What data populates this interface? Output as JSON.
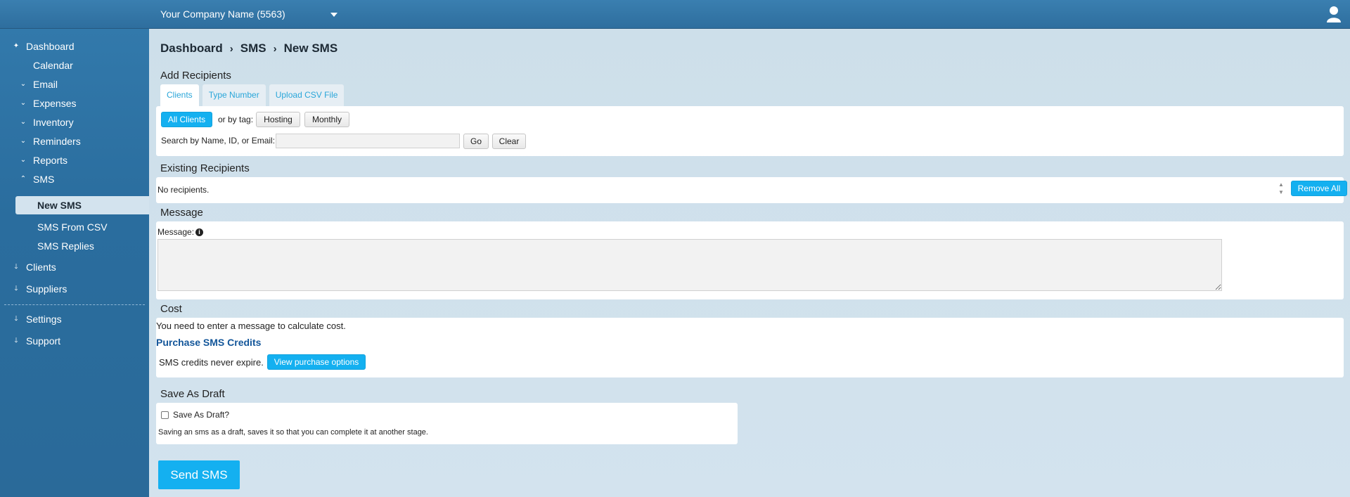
{
  "header": {
    "company_name": "Your Company Name (5563)"
  },
  "sidebar": {
    "items": [
      {
        "label": "Dashboard"
      },
      {
        "label": "Calendar"
      },
      {
        "label": "Email"
      },
      {
        "label": "Expenses"
      },
      {
        "label": "Inventory"
      },
      {
        "label": "Reminders"
      },
      {
        "label": "Reports"
      },
      {
        "label": "SMS"
      },
      {
        "label": "New SMS"
      },
      {
        "label": "SMS From CSV"
      },
      {
        "label": "SMS Replies"
      },
      {
        "label": "Clients"
      },
      {
        "label": "Suppliers"
      },
      {
        "label": "Settings"
      },
      {
        "label": "Support"
      }
    ]
  },
  "breadcrumb": [
    "Dashboard",
    "SMS",
    "New SMS"
  ],
  "add_recipients": {
    "title": "Add Recipients",
    "tabs": [
      "Clients",
      "Type Number",
      "Upload CSV File"
    ],
    "all_clients_label": "All Clients",
    "or_by_tag": "or by tag:",
    "tags": [
      "Hosting",
      "Monthly"
    ],
    "search_label": "Search by Name, ID, or Email:",
    "search_value": "",
    "go_label": "Go",
    "clear_label": "Clear"
  },
  "existing_recipients": {
    "title": "Existing Recipients",
    "empty_text": "No recipients.",
    "remove_all_label": "Remove All"
  },
  "message": {
    "title": "Message",
    "label": "Message:",
    "value": ""
  },
  "cost": {
    "title": "Cost",
    "hint": "You need to enter a message to calculate cost.",
    "purchase_link": "Purchase SMS Credits",
    "credits_text": "SMS credits never expire.",
    "view_options_label": "View purchase options"
  },
  "draft": {
    "title": "Save As Draft",
    "checkbox_label": "Save As Draft?",
    "description": "Saving an sms as a draft, saves it so that you can complete it at another stage."
  },
  "send_label": "Send SMS",
  "colors": {
    "accent": "#14b0f0",
    "sidebar": "#2a6d9e",
    "link": "#13569a"
  }
}
